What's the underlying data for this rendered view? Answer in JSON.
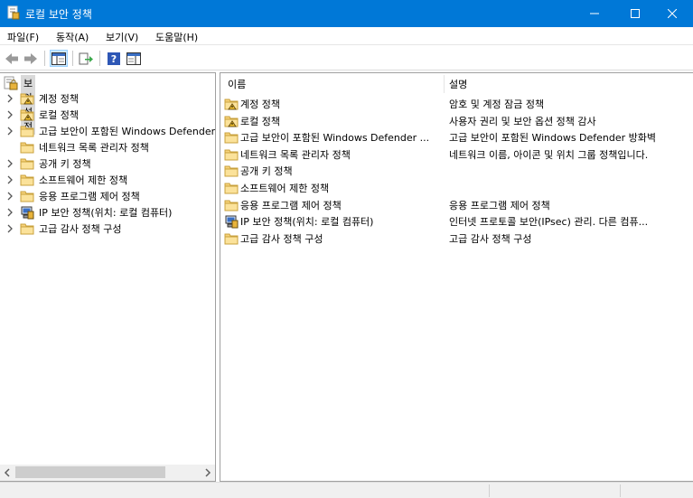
{
  "window": {
    "title": "로컬 보안 정책",
    "accent": "#0078d7"
  },
  "menu": [
    {
      "label": "파일(F)"
    },
    {
      "label": "동작(A)"
    },
    {
      "label": "보기(V)"
    },
    {
      "label": "도움말(H)"
    }
  ],
  "toolbar": {
    "buttons": [
      "back-icon",
      "forward-icon",
      "show-hide-tree-icon",
      "export-list-icon",
      "help-icon",
      "action-pane-icon"
    ]
  },
  "tree": {
    "root_label": "보안 설정",
    "items": [
      {
        "label": "계정 정책",
        "icon": "policy-folder-icon",
        "expandable": true
      },
      {
        "label": "로컬 정책",
        "icon": "policy-folder-icon",
        "expandable": true
      },
      {
        "label": "고급 보안이 포함된 Windows Defender",
        "icon": "folder-icon",
        "expandable": true
      },
      {
        "label": "네트워크 목록 관리자 정책",
        "icon": "folder-icon",
        "expandable": false
      },
      {
        "label": "공개 키 정책",
        "icon": "folder-icon",
        "expandable": true
      },
      {
        "label": "소프트웨어 제한 정책",
        "icon": "folder-icon",
        "expandable": true
      },
      {
        "label": "응용 프로그램 제어 정책",
        "icon": "folder-icon",
        "expandable": true
      },
      {
        "label": "IP 보안 정책(위치: 로컬 컴퓨터)",
        "icon": "ip-security-icon",
        "expandable": true
      },
      {
        "label": "고급 감사 정책 구성",
        "icon": "folder-icon",
        "expandable": true
      }
    ]
  },
  "list": {
    "columns": {
      "name": "이름",
      "description": "설명"
    },
    "rows": [
      {
        "name": "계정 정책",
        "description": "암호 및 계정 잠금 정책",
        "icon": "policy-folder-icon"
      },
      {
        "name": "로컬 정책",
        "description": "사용자 권리 및 보안 옵션 정책 감사",
        "icon": "policy-folder-icon"
      },
      {
        "name": "고급 보안이 포함된 Windows Defender ...",
        "description": "고급 보안이 포함된 Windows Defender 방화벽",
        "icon": "folder-icon"
      },
      {
        "name": "네트워크 목록 관리자 정책",
        "description": "네트워크 이름, 아이콘 및 위치 그룹 정책입니다.",
        "icon": "folder-icon"
      },
      {
        "name": "공개 키 정책",
        "description": "",
        "icon": "folder-icon"
      },
      {
        "name": "소프트웨어 제한 정책",
        "description": "",
        "icon": "folder-icon"
      },
      {
        "name": "응용 프로그램 제어 정책",
        "description": "응용 프로그램 제어 정책",
        "icon": "folder-icon"
      },
      {
        "name": "IP 보안 정책(위치: 로컬 컴퓨터)",
        "description": "인터넷 프로토콜 보안(IPsec) 관리. 다른 컴퓨...",
        "icon": "ip-security-icon"
      },
      {
        "name": "고급 감사 정책 구성",
        "description": "고급 감사 정책 구성",
        "icon": "folder-icon"
      }
    ]
  }
}
